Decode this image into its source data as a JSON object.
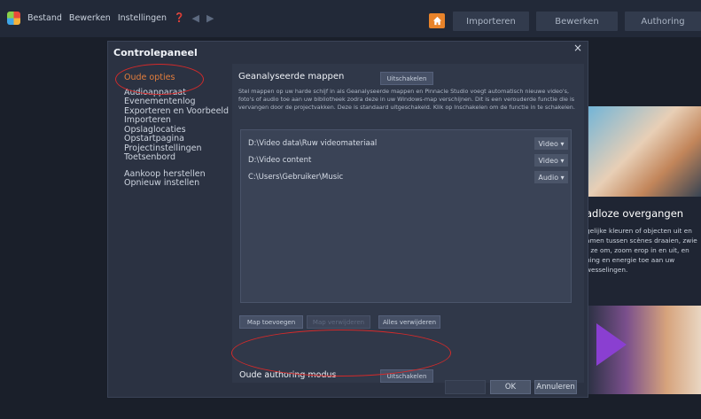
{
  "menu": {
    "items": [
      "Bestand",
      "Bewerken",
      "Instellingen"
    ],
    "help_icon": "help-icon",
    "undo_icon": "undo-icon",
    "redo_icon": "redo-icon"
  },
  "nav": {
    "home_icon": "home-icon",
    "tabs": [
      "Importeren",
      "Bewerken",
      "Authoring"
    ],
    "accent": "#e8832a"
  },
  "dialog": {
    "title": "Controlepaneel",
    "close": "×",
    "sidebar": {
      "active": "Oude opties",
      "items": [
        "Audioapparaat",
        "Evenementenlog",
        "Exporteren en Voorbeeld",
        "Importeren",
        "Opslaglocaties",
        "Opstartpagina",
        "Projectinstellingen",
        "Toetsenbord"
      ],
      "extra": [
        "Aankoop herstellen",
        "Opnieuw instellen"
      ]
    },
    "section1": {
      "title": "Geanalyseerde mappen",
      "button": "Uitschakelen",
      "description": "Stel mappen op uw harde schijf in als Geanalyseerde mappen en Pinnacle Studio voegt automatisch nieuwe video's, foto's of audio toe aan uw bibliotheek zodra deze in uw Windows-map verschijnen. Dit is een verouderde functie die is vervangen door de projectvakken. Deze is standaard uitgeschakeld. Klik op Inschakelen om de functie in te schakelen.",
      "folders": [
        {
          "path": "D:\\Video data\\Ruw videomateriaal",
          "type": "Video"
        },
        {
          "path": "D:\\Video content",
          "type": "Video"
        },
        {
          "path": "C:\\Users\\Gebruiker\\Music",
          "type": "Audio"
        }
      ],
      "buttons": [
        "Map toevoegen",
        "Map verwijderen",
        "Alles verwijderen"
      ]
    },
    "section2": {
      "title": "Oude authoring modus",
      "button": "Uitschakelen"
    },
    "footer": {
      "disabled": "",
      "ok": "OK",
      "cancel": "Annuleren"
    }
  },
  "promo": {
    "title": "adloze overgangen",
    "text": "gelijke kleuren of objecten uit en amen tussen scènes draaien, zwie r ze om, zoom erop in en uit, en ning en energie toe aan uw wesselingen."
  },
  "colors": {
    "annotation": "#d42a2a",
    "active_sidebar": "#e57e3c"
  }
}
